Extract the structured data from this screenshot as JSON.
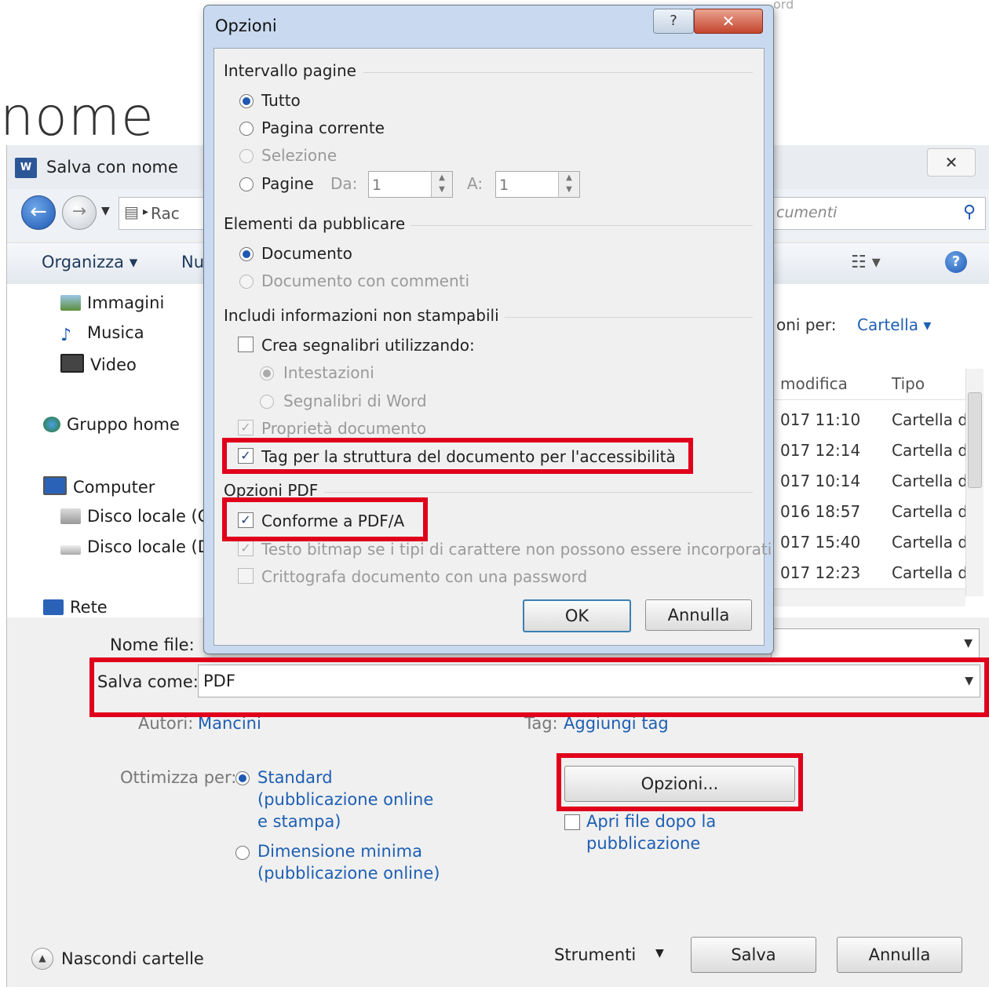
{
  "background": {
    "title_fragment": "nome",
    "top_right_fragment": "ord"
  },
  "save_dialog": {
    "title": "Salva con nome",
    "close": "✕",
    "address": "Rac",
    "search_placeholder": "cumenti",
    "toolbar": {
      "organize": "Organizza ▾",
      "new": "Nu"
    },
    "nav_items": [
      {
        "label": "Immagini",
        "icon": "pictures-icon"
      },
      {
        "label": "Musica",
        "icon": "music-icon"
      },
      {
        "label": "Video",
        "icon": "video-icon"
      },
      {
        "label": "Gruppo home",
        "icon": "homegroup-icon"
      },
      {
        "label": "Computer",
        "icon": "computer-icon"
      },
      {
        "label": "Disco locale (C",
        "icon": "drive-icon"
      },
      {
        "label": "Disco locale (D",
        "icon": "drive-icon"
      },
      {
        "label": "Rete",
        "icon": "network-icon"
      }
    ],
    "arrange": {
      "label": "oni per:",
      "value": "Cartella ▾"
    },
    "columns": {
      "modified": "modifica",
      "type": "Tipo"
    },
    "files": [
      {
        "date": "017 11:10",
        "type": "Cartella d"
      },
      {
        "date": "017 12:14",
        "type": "Cartella d"
      },
      {
        "date": "017 10:14",
        "type": "Cartella d"
      },
      {
        "date": "016 18:57",
        "type": "Cartella d"
      },
      {
        "date": "017 15:40",
        "type": "Cartella d"
      },
      {
        "date": "017 12:23",
        "type": "Cartella d"
      }
    ],
    "filename_label": "Nome file:",
    "saveas_label": "Salva come:",
    "saveas_value": "PDF",
    "authors_label": "Autori:",
    "authors_value": "Mancini",
    "tags_label": "Tag:",
    "tags_value": "Aggiungi tag",
    "optimize_label": "Ottimizza per:",
    "optimize_standard": [
      "Standard",
      "(pubblicazione online",
      "e stampa)"
    ],
    "optimize_min": [
      "Dimensione minima",
      "(pubblicazione online)"
    ],
    "options_button": "Opzioni...",
    "open_after": [
      "Apri file dopo la",
      "pubblicazione"
    ],
    "hide_folders": "Nascondi cartelle",
    "tools": "Strumenti",
    "save": "Salva",
    "cancel": "Annulla"
  },
  "options_dialog": {
    "title": "Opzioni",
    "help": "?",
    "close": "✕",
    "page_range": {
      "header": "Intervallo pagine",
      "all": "Tutto",
      "current": "Pagina corrente",
      "selection": "Selezione",
      "pages": "Pagine",
      "from_label": "Da:",
      "from_value": "1",
      "to_label": "A:",
      "to_value": "1"
    },
    "publish": {
      "header": "Elementi da pubblicare",
      "document": "Documento",
      "with_comments": "Documento con commenti"
    },
    "nonprint": {
      "header": "Includi informazioni non stampabili",
      "bookmarks": "Crea segnalibri utilizzando:",
      "headings": "Intestazioni",
      "word_bookmarks": "Segnalibri di Word",
      "properties": "Proprietà documento",
      "tags": "Tag per la struttura del documento per l'accessibilità"
    },
    "pdf": {
      "header": "Opzioni PDF",
      "pdfa": "Conforme a PDF/A",
      "bitmap": "Testo bitmap se i tipi di carattere non possono essere incorporati",
      "encrypt": "Crittografa documento con una password"
    },
    "ok": "OK",
    "cancel": "Annulla"
  },
  "colors": {
    "highlight": "#e0001b",
    "link": "#1e5fb3",
    "accent": "#1d58b3"
  }
}
